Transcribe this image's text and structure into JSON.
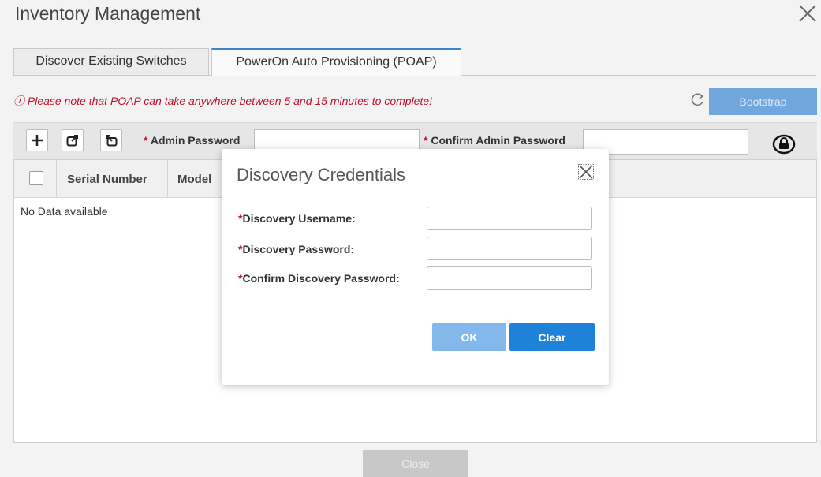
{
  "window": {
    "title": "Inventory Management"
  },
  "tabs": [
    {
      "label": "Discover Existing Switches",
      "active": false
    },
    {
      "label": "PowerOn Auto Provisioning (POAP)",
      "active": true
    }
  ],
  "notice": {
    "text": "Please note that POAP can take anywhere between 5 and 15 minutes to complete!"
  },
  "toolbar": {
    "bootstrap_label": "Bootstrap",
    "admin_password_label": "Admin Password",
    "confirm_admin_password_label": "Confirm Admin Password",
    "required_marker": "*",
    "icons": [
      "plus-icon",
      "export-icon",
      "import-icon",
      "lock-icon",
      "refresh-icon"
    ]
  },
  "table": {
    "columns": [
      "Serial Number",
      "Model"
    ],
    "empty_text": "No Data available"
  },
  "footer": {
    "close_label": "Close"
  },
  "modal": {
    "title": "Discovery Credentials",
    "fields": [
      {
        "label": "Discovery Username:",
        "value": ""
      },
      {
        "label": "Discovery Password:",
        "value": ""
      },
      {
        "label": "Confirm Discovery Password:",
        "value": ""
      }
    ],
    "ok_label": "OK",
    "clear_label": "Clear"
  },
  "colors": {
    "accent": "#1f82d9",
    "accent_disabled": "#82b8ec",
    "warning_text": "#c0102a",
    "bootstrap_disabled": "#6fa7dd"
  }
}
